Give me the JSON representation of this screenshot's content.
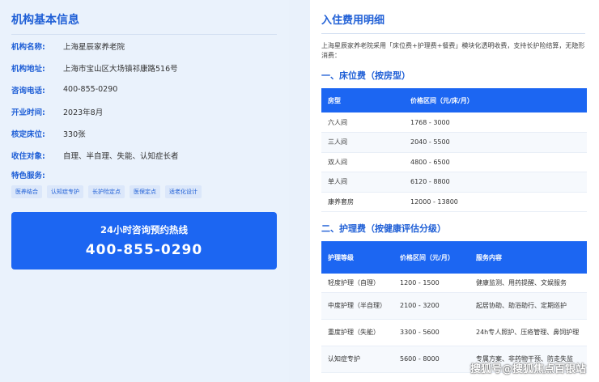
{
  "left": {
    "title": "机构基本信息",
    "rows": [
      {
        "label": "机构名称:",
        "value": "上海星辰家养老院"
      },
      {
        "label": "机构地址:",
        "value": "上海市宝山区大场镇祁康路516号"
      },
      {
        "label": "咨询电话:",
        "value": "400-855-0290"
      },
      {
        "label": "开业时间:",
        "value": "2023年8月"
      },
      {
        "label": "核定床位:",
        "value": "330张"
      },
      {
        "label": "收住对象:",
        "value": "自理、半自理、失能、认知症长者"
      }
    ],
    "features_label": "特色服务:",
    "tags": [
      "医养结合",
      "认知症专护",
      "长护险定点",
      "医保定点",
      "适老化设计"
    ],
    "hotline": {
      "title": "24小时咨询预约热线",
      "phone": "400-855-0290"
    }
  },
  "right": {
    "title": "入住费用明细",
    "intro": "上海星辰家养老院采用「床位费+护理费+餐费」模块化透明收费，支持长护险结算，无隐形消费：",
    "section1": {
      "title": "一、床位费（按房型）",
      "headers": [
        "房型",
        "价格区间（元/床/月）"
      ],
      "rows": [
        [
          "六人间",
          "1768 - 3000"
        ],
        [
          "三人间",
          "2040 - 5500"
        ],
        [
          "双人间",
          "4800 - 6500"
        ],
        [
          "单人间",
          "6120 - 8800"
        ],
        [
          "康养套房",
          "12000 - 13800"
        ]
      ]
    },
    "section2": {
      "title": "二、护理费（按健康评估分级）",
      "headers": [
        "护理等级",
        "价格区间（元/月）",
        "服务内容"
      ],
      "rows": [
        [
          "轻度护理（自理）",
          "1200 - 1500",
          "健康监测、用药提醒、文娱服务"
        ],
        [
          "中度护理（半自理）",
          "2100 - 3200",
          "起居协助、助浴助行、定期巡护"
        ],
        [
          "重度护理（失能）",
          "3300 - 5600",
          "24h专人照护、压疮管理、鼻饲护理"
        ],
        [
          "认知症专护",
          "5600 - 8000",
          "专属方案、非药物干预、防走失监"
        ]
      ]
    }
  },
  "watermark": "搜狐号@搜狐焦点百银站"
}
